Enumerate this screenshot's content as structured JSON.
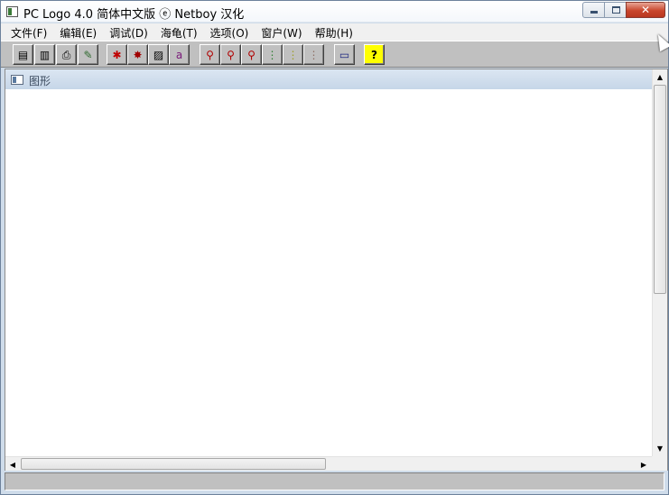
{
  "window": {
    "title": "PC Logo 4.0 简体中文版  ⓔ Netboy  汉化",
    "close_glyph": "✕"
  },
  "menu": [
    {
      "label": "文件(F)"
    },
    {
      "label": "编辑(E)"
    },
    {
      "label": "调试(D)"
    },
    {
      "label": "海龟(T)"
    },
    {
      "label": "选项(O)"
    },
    {
      "label": "窗户(W)"
    },
    {
      "label": "帮助(H)"
    }
  ],
  "toolbar": {
    "buttons": [
      {
        "name": "open-icon",
        "glyph": "▤",
        "color": "#000000"
      },
      {
        "name": "load-icon",
        "glyph": "▥",
        "color": "#000000"
      },
      {
        "name": "print-icon",
        "glyph": "⎙",
        "color": "#000000"
      },
      {
        "name": "edit-icon",
        "glyph": "✎",
        "color": "#2f6a2f"
      },
      {
        "name": "turtle-red-icon",
        "glyph": "✱",
        "color": "#c00000"
      },
      {
        "name": "turtle-icon",
        "glyph": "✸",
        "color": "#a00000"
      },
      {
        "name": "pattern-icon",
        "glyph": "▨",
        "color": "#000000"
      },
      {
        "name": "text-icon",
        "glyph": "a",
        "color": "#7a1a7a"
      },
      {
        "name": "zoom-in-icon",
        "glyph": "⚲",
        "color": "#b00000"
      },
      {
        "name": "zoom-icon",
        "glyph": "⚲",
        "color": "#b00000"
      },
      {
        "name": "zoom-out-icon",
        "glyph": "⚲",
        "color": "#b00000"
      },
      {
        "name": "traffic-light-go-icon",
        "glyph": "⋮",
        "color": "#2e7d32"
      },
      {
        "name": "traffic-light-step-icon",
        "glyph": "⋮",
        "color": "#9e9d24"
      },
      {
        "name": "traffic-light-stop-icon",
        "glyph": "⋮",
        "color": "#8d6e63"
      },
      {
        "name": "screen-icon",
        "glyph": "▭",
        "color": "#1a237e"
      },
      {
        "name": "help-icon",
        "glyph": "?",
        "color": "#000000"
      }
    ]
  },
  "graphics_window": {
    "title": "图形"
  },
  "scroll": {
    "up": "▲",
    "down": "▼",
    "left": "◀",
    "right": "▶"
  }
}
